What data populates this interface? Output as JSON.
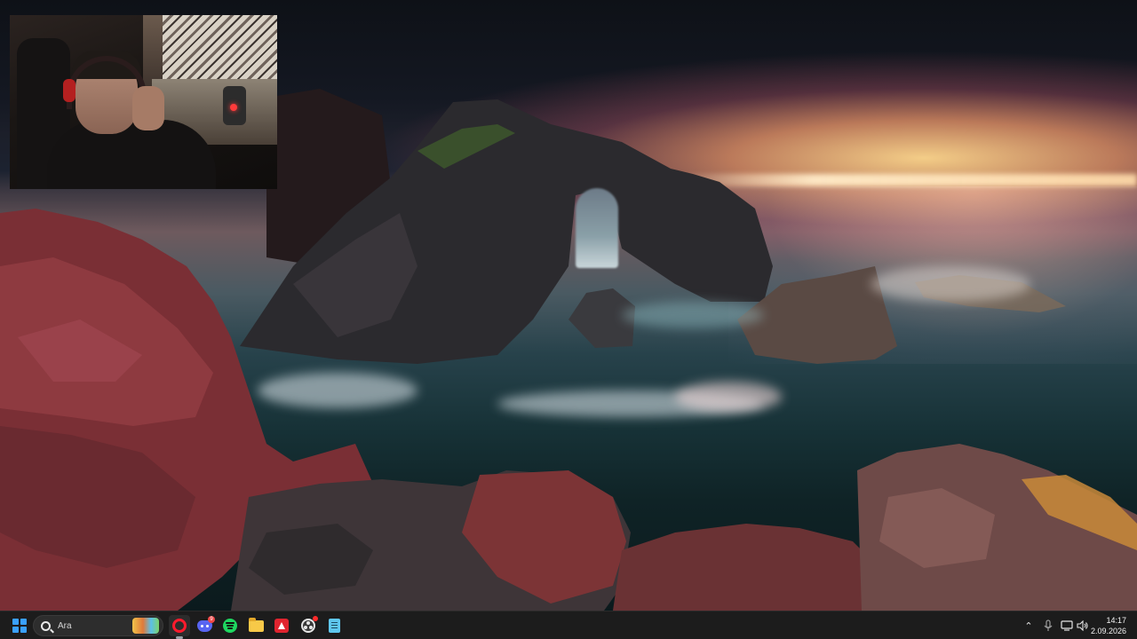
{
  "taskbar": {
    "search": {
      "placeholder": "Ara"
    },
    "pinned_apps": [
      {
        "name": "opera-gx",
        "icon": "opera-icon",
        "active": true
      },
      {
        "name": "discord",
        "icon": "discord-icon",
        "badge": "9"
      },
      {
        "name": "spotify",
        "icon": "spotify-icon"
      },
      {
        "name": "file-explorer",
        "icon": "folder-icon"
      },
      {
        "name": "rider",
        "icon": "rider-icon"
      },
      {
        "name": "obs",
        "icon": "obs-icon",
        "recording": true
      },
      {
        "name": "notepad",
        "icon": "notepad-icon"
      }
    ],
    "tray": {
      "icons": [
        "chevron-up-icon",
        "microphone-icon",
        "network-icon",
        "speaker-icon"
      ]
    },
    "clock": {
      "time": "14:17",
      "date": "2.09.2026"
    }
  },
  "colors": {
    "taskbar_bg": "#1c1c1c",
    "start_accent": "#3aa0ff",
    "opera_red": "#ff1b2d",
    "discord_blurple": "#5865f2",
    "spotify_green": "#1ed760",
    "notification_red": "#f04747"
  },
  "icons": {
    "chevron_up": "⌃",
    "microphone": "🎙",
    "network": "🖧",
    "speaker": "🔊"
  }
}
